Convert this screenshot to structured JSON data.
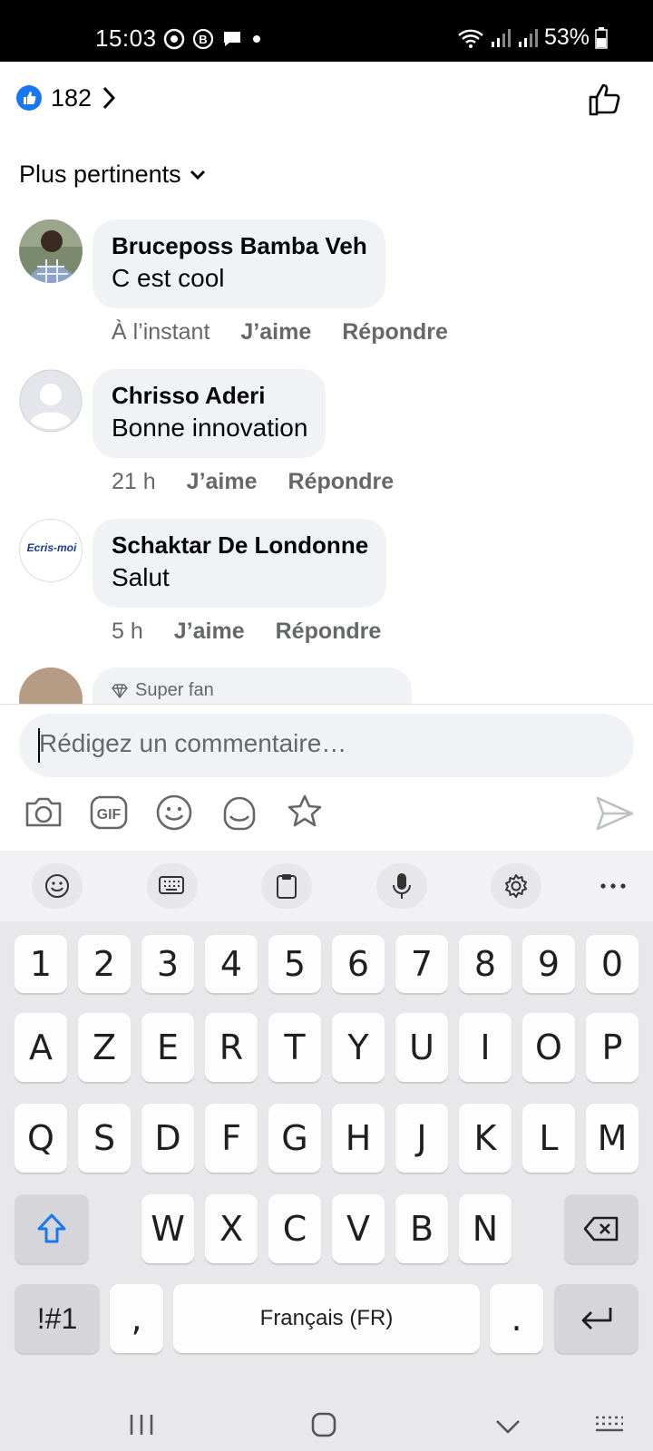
{
  "status_bar": {
    "time": "15:03",
    "battery": "53%",
    "left_icons": [
      "chrome-icon",
      "b-icon",
      "chat-icon",
      "dot-icon"
    ],
    "right_icons": [
      "wifi-icon",
      "signal-icon",
      "signal-icon",
      "battery-icon"
    ]
  },
  "header": {
    "reaction_count": "182",
    "sort_label": "Plus pertinents"
  },
  "comments": [
    {
      "author": "Bruceposs Bamba Veh",
      "text": "C est cool",
      "time": "À l’instant",
      "like": "J’aime",
      "reply": "Répondre"
    },
    {
      "author": "Chrisso Aderi",
      "text": "Bonne innovation",
      "time": "21 h",
      "like": "J’aime",
      "reply": "Répondre"
    },
    {
      "author": "Schaktar De Londonne",
      "text": "Salut",
      "time": "5 h",
      "like": "J’aime",
      "reply": "Répondre",
      "avatar_text": "Ecris-moi"
    },
    {
      "badge": "Super fan"
    }
  ],
  "composer": {
    "placeholder": "Rédigez un commentaire…"
  },
  "keyboard": {
    "row_numbers": [
      "1",
      "2",
      "3",
      "4",
      "5",
      "6",
      "7",
      "8",
      "9",
      "0"
    ],
    "row1": [
      "A",
      "Z",
      "E",
      "R",
      "T",
      "Y",
      "U",
      "I",
      "O",
      "P"
    ],
    "row2": [
      "Q",
      "S",
      "D",
      "F",
      "G",
      "H",
      "J",
      "K",
      "L",
      "M"
    ],
    "row3": [
      "W",
      "X",
      "C",
      "V",
      "B",
      "N"
    ],
    "symbols_label": "!#1",
    "comma": ",",
    "space_label": "Français (FR)",
    "period": "."
  },
  "colors": {
    "fb_blue": "#1877f2",
    "bubble_bg": "#f0f2f5",
    "meta_text": "#65676b"
  }
}
